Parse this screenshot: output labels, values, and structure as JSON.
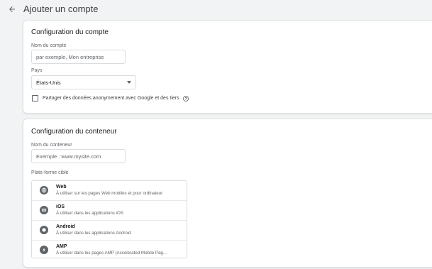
{
  "header": {
    "title": "Ajouter un compte"
  },
  "account": {
    "title": "Configuration du compte",
    "name_label": "Nom du compte",
    "name_placeholder": "par exemple, Mon entreprise",
    "country_label": "Pays",
    "country_value": "États-Unis",
    "share_label": "Partager des données anonymement avec Google et des tiers"
  },
  "container": {
    "title": "Configuration du conteneur",
    "name_label": "Nom du conteneur",
    "name_placeholder": "Exemple : www.mysite.com",
    "platform_label": "Plate-forme cible",
    "platforms": [
      {
        "name": "Web",
        "desc": "À utiliser sur les pages Web mobiles et pour ordinateur",
        "icon": "globe-icon"
      },
      {
        "name": "iOS",
        "desc": "À utiliser dans les applications iOS",
        "icon": "ios-icon"
      },
      {
        "name": "Android",
        "desc": "À utiliser dans les applications Android",
        "icon": "android-icon"
      },
      {
        "name": "AMP",
        "desc": "À utiliser dans les pages AMP (Accelerated Mobile Pag...",
        "icon": "amp-icon"
      }
    ]
  },
  "colors": {
    "background": "#f1f3f4",
    "card": "#ffffff",
    "icon_circle": "#5f6368"
  }
}
